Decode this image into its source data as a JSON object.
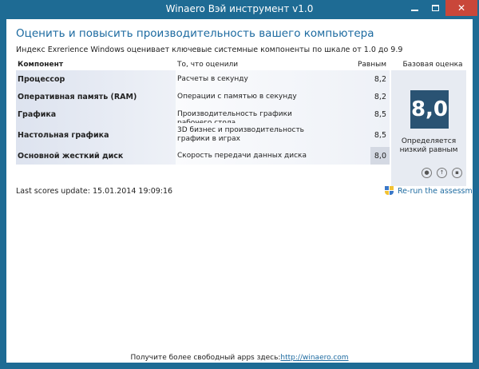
{
  "window": {
    "title": "Winaero Вэй инструмент v1.0",
    "colors": {
      "frame": "#1e6b94",
      "close": "#c9473a",
      "accent": "#1c6aa0",
      "base_score_box": "#2a5373"
    }
  },
  "heading": "Оценить и повысить производительность вашего компьютера",
  "subheading": "Индекс Exrerience Windows оценивает ключевые системные компоненты по шкале от 1.0 до 9.9",
  "table": {
    "headers": {
      "component": "Компонент",
      "rated": "То, что оценили",
      "score": "Равным",
      "base": "Базовая оценка"
    },
    "rows": [
      {
        "component": "Процессор",
        "rated": "Расчеты в секунду",
        "score": "8,2"
      },
      {
        "component": "Оперативная память (RAM)",
        "rated": "Операции с памятью в секунду",
        "score": "8,2"
      },
      {
        "component": "Графика",
        "rated": "Производительность графики рабочего стола",
        "score": "8,5"
      },
      {
        "component": "Настольная графика",
        "rated": "3D бизнес и производительность графики в играх",
        "score": "8,5"
      },
      {
        "component": "Основной жесткий диск",
        "rated": "Скорость передачи данных диска",
        "score": "8,0"
      }
    ]
  },
  "base_score": {
    "value": "8,0",
    "caption": "Определяется низкий равным"
  },
  "action_icons": [
    "camera-icon",
    "upload-icon",
    "save-icon"
  ],
  "last_update": "Last scores update: 15.01.2014 19:09:16",
  "rerun": "Re-run the assessment",
  "footer": {
    "text": "Получите более свободный apps здесь:",
    "link": "http://winaero.com"
  }
}
